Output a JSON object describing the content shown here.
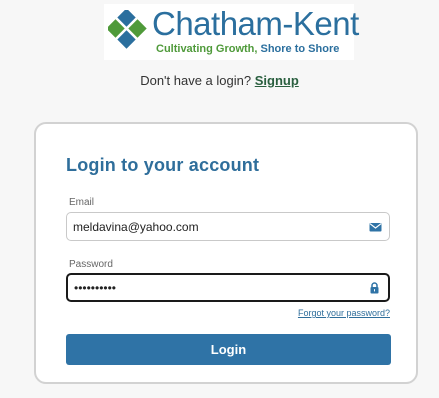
{
  "brand": {
    "name": "Chatham-Kent",
    "tagline_green": "Cultivating Growth, ",
    "tagline_blue": "Shore to Shore",
    "colors": {
      "blue": "#2b6f9e",
      "green": "#4f9a3a"
    }
  },
  "signup": {
    "prompt": "Don't have a login?",
    "link_label": "Signup"
  },
  "login_form": {
    "title": "Login to your account",
    "email_label": "Email",
    "email_value": "meldavina@yahoo.com",
    "email_icon": "envelope-icon",
    "password_label": "Password",
    "password_value": "••••••••••",
    "password_icon": "lock-icon",
    "forgot_label": "Forgot your password?",
    "submit_label": "Login",
    "accent_color": "#2f73a6"
  }
}
